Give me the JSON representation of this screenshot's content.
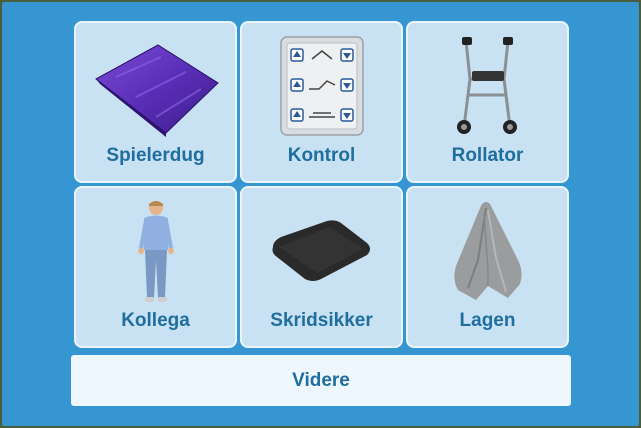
{
  "items": [
    {
      "label": "Spielerdug",
      "icon": "purple-slide-sheet-icon"
    },
    {
      "label": "Kontrol",
      "icon": "bed-remote-control-icon"
    },
    {
      "label": "Rollator",
      "icon": "rollator-walker-icon"
    },
    {
      "label": "Kollega",
      "icon": "colleague-person-icon"
    },
    {
      "label": "Skridsikker",
      "icon": "anti-slip-mat-icon"
    },
    {
      "label": "Lagen",
      "icon": "bed-sheet-icon"
    }
  ],
  "next_button": {
    "label": "Videre"
  },
  "colors": {
    "background": "#3596d2",
    "tile": "#c8e2f3",
    "label": "#1f6e9d",
    "button": "#eef7fd"
  }
}
